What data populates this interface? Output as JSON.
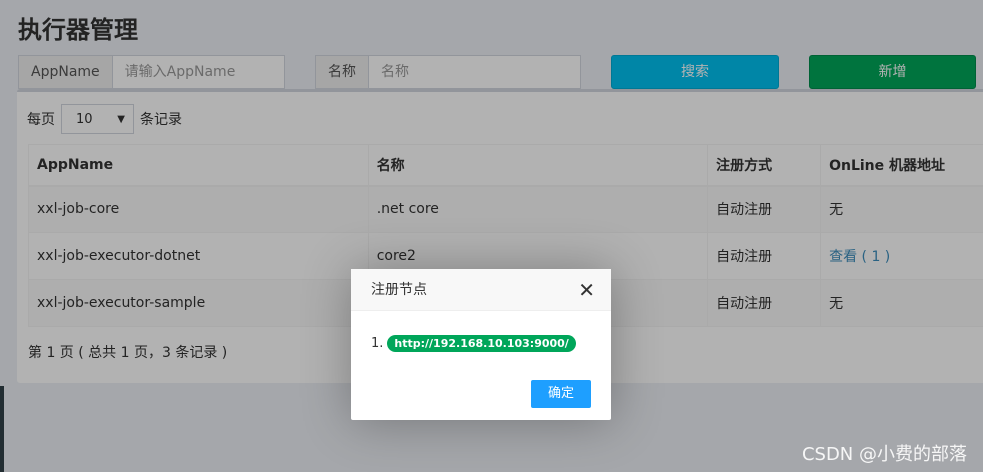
{
  "page": {
    "title": "执行器管理"
  },
  "search": {
    "appname_label": "AppName",
    "appname_placeholder": "请输入AppName",
    "name_label": "名称",
    "name_placeholder": "名称",
    "search_button": "搜索",
    "add_button": "新增"
  },
  "table": {
    "length_prefix": "每页",
    "length_value": "10",
    "length_suffix": "条记录",
    "columns": [
      "AppName",
      "名称",
      "注册方式",
      "OnLine 机器地址"
    ],
    "rows": [
      {
        "appname": "xxl-job-core",
        "name": ".net core",
        "reg": "自动注册",
        "online": "无"
      },
      {
        "appname": "xxl-job-executor-dotnet",
        "name": "core2",
        "reg": "自动注册",
        "online": "查看 ( 1 )"
      },
      {
        "appname": "xxl-job-executor-sample",
        "name": "",
        "reg": "自动注册",
        "online": "无"
      }
    ],
    "info": "第 1 页 ( 总共 1 页，3 条记录 )"
  },
  "modal": {
    "title": "注册节点",
    "close": "✕",
    "item_index": "1.",
    "item_address": "http://192.168.10.103:9000/",
    "ok_button": "确定"
  },
  "watermark": "CSDN @小费的部落",
  "colors": {
    "search_button": "#00c0ef",
    "add_button": "#00a65a",
    "link": "#3c8dbc",
    "badge": "#00a65a",
    "modal_ok": "#1e9fff"
  },
  "icons": {
    "select_chevron": "chevron-down-icon",
    "modal_close": "close-icon"
  }
}
